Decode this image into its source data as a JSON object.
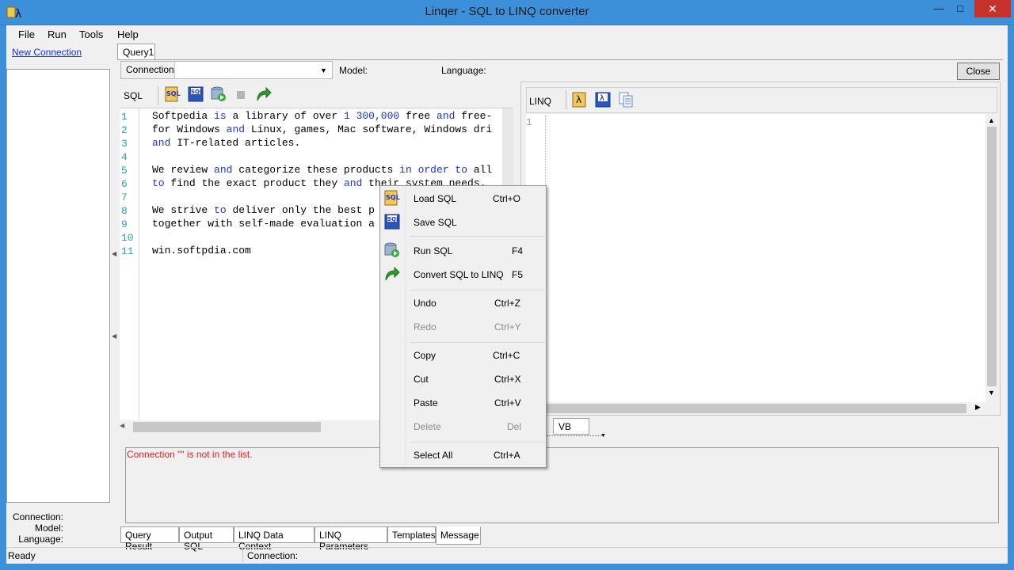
{
  "window": {
    "title": "Linqer - SQL to LINQ converter"
  },
  "menu": [
    "File",
    "Run",
    "Tools",
    "Help"
  ],
  "left": {
    "new_connection": "New Connection",
    "connection_label": "Connection:",
    "model_label": "Model:",
    "language_label": "Language:"
  },
  "query_tab": "Query1",
  "conn_row": {
    "connection_label": "Connection",
    "model_label": "Model:",
    "language_label": "Language:",
    "close_button": "Close"
  },
  "sql": {
    "label": "SQL",
    "line_numbers": [
      "1",
      "2",
      "3",
      "4",
      "5",
      "6",
      "7",
      "8",
      "9",
      "10",
      "11"
    ],
    "lines": [
      "Softpedia is a library of over 1 300,000 free and free-",
      "for Windows and Linux, games, Mac software, Windows dri",
      "and IT-related articles.",
      "",
      "We review and categorize these products in order to all",
      "to find the exact product they and their system needs.",
      "",
      "We strive to deliver only the best p",
      "together with self-made evaluation a",
      "",
      "win.softpdia.com"
    ]
  },
  "linq": {
    "label": "LINQ",
    "line_numbers": [
      "1"
    ],
    "vb_tab": "VB"
  },
  "message": {
    "text": "Connection \"\" is not in the list."
  },
  "bottom_tabs": [
    "Query Result",
    "Output SQL",
    "LINQ Data Context",
    "LINQ Parameters",
    "Templates",
    "Message"
  ],
  "status": {
    "ready": "Ready",
    "connection": "Connection:"
  },
  "context_menu": {
    "items": [
      {
        "label": "Load SQL",
        "shortcut": "Ctrl+O",
        "icon": "load-sql-icon",
        "enabled": true
      },
      {
        "label": "Save SQL",
        "shortcut": "",
        "icon": "save-sql-icon",
        "enabled": true
      },
      {
        "label": "Run SQL",
        "shortcut": "F4",
        "icon": "run-sql-icon",
        "enabled": true
      },
      {
        "label": "Convert SQL to LINQ",
        "shortcut": "F5",
        "icon": "convert-arrow-icon",
        "enabled": true
      },
      {
        "label": "Undo",
        "shortcut": "Ctrl+Z",
        "enabled": true
      },
      {
        "label": "Redo",
        "shortcut": "Ctrl+Y",
        "enabled": false
      },
      {
        "label": "Copy",
        "shortcut": "Ctrl+C",
        "enabled": true
      },
      {
        "label": "Cut",
        "shortcut": "Ctrl+X",
        "enabled": true
      },
      {
        "label": "Paste",
        "shortcut": "Ctrl+V",
        "enabled": true
      },
      {
        "label": "Delete",
        "shortcut": "Del",
        "enabled": false
      },
      {
        "label": "Select All",
        "shortcut": "Ctrl+A",
        "enabled": true
      }
    ]
  },
  "colors": {
    "titlebar": "#3c8fd9",
    "keyword": "#1b33d6",
    "line_number": "#2aa3a3",
    "error": "#e02020",
    "close": "#c7312b"
  }
}
